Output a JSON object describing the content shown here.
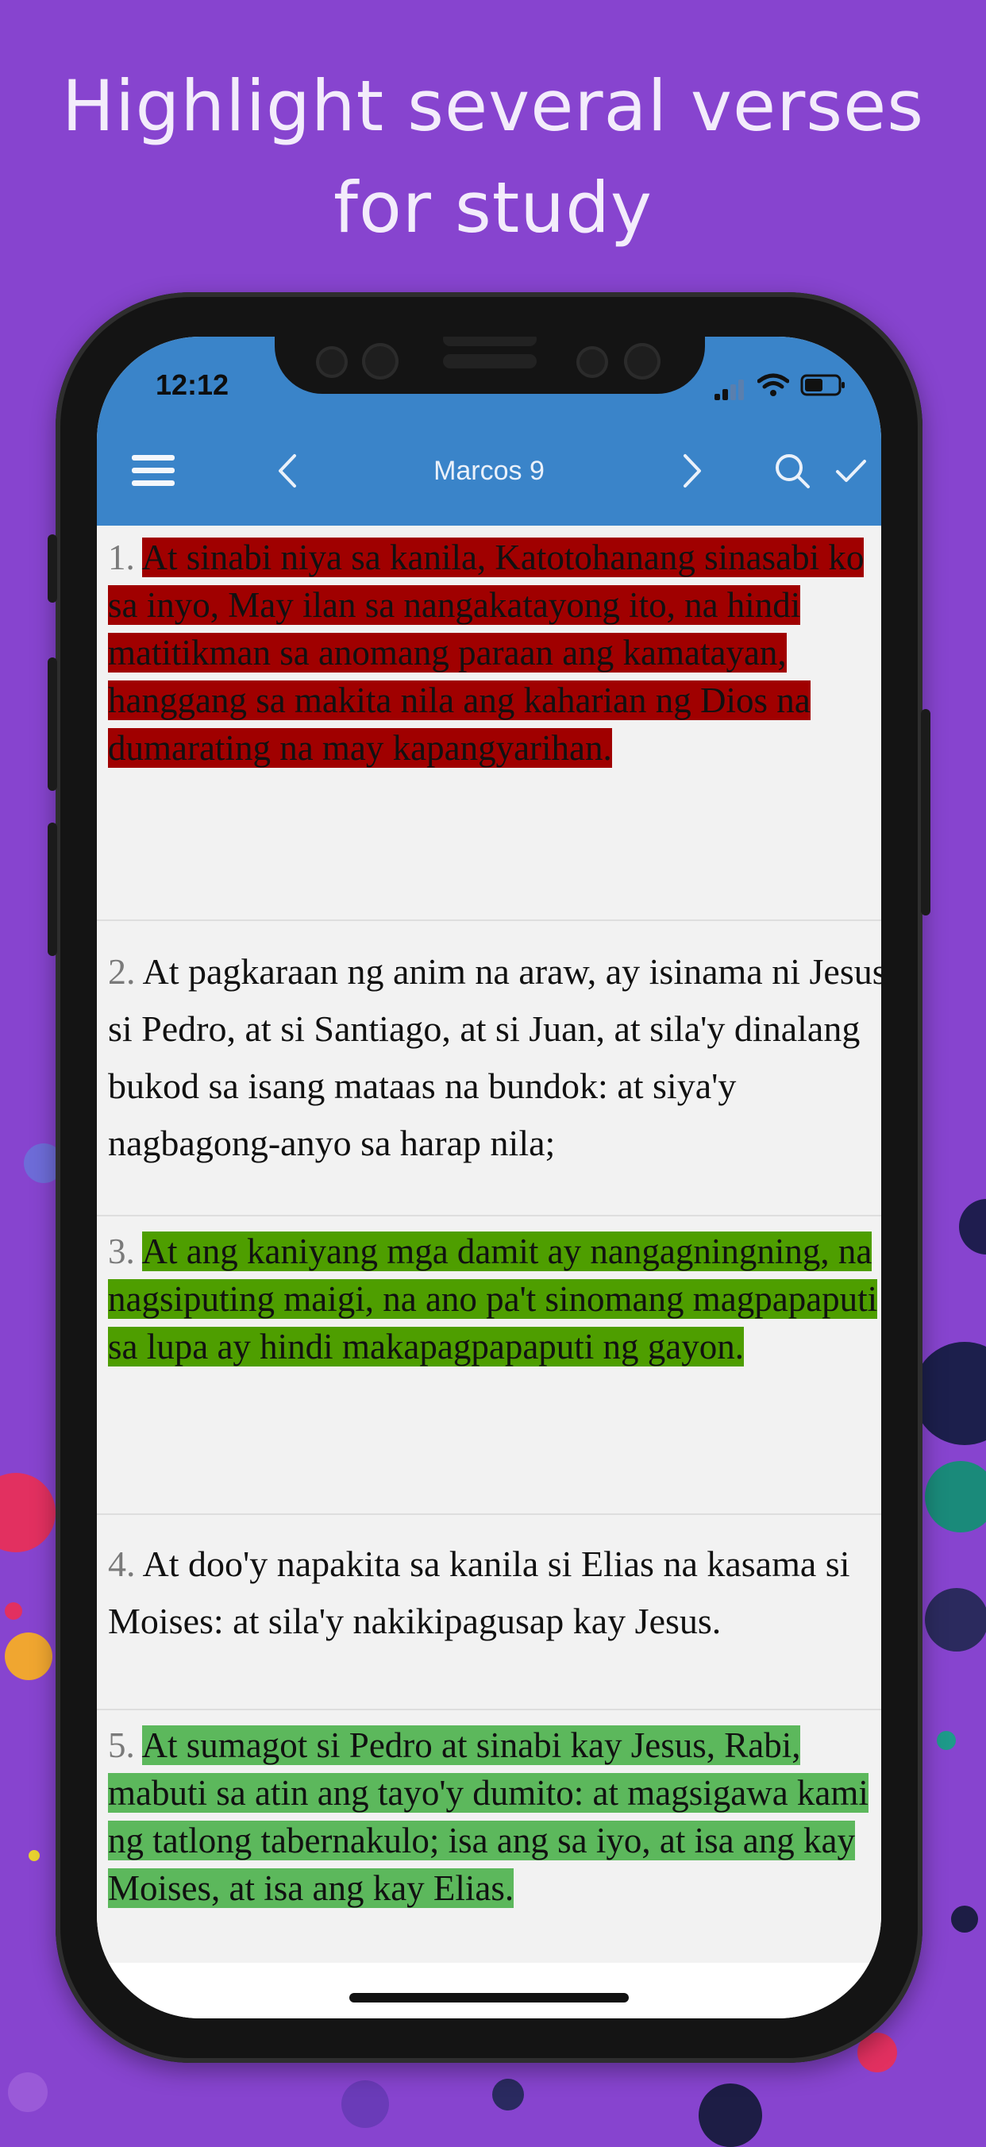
{
  "headline": {
    "line1": "Highlight several verses",
    "line2": "for study"
  },
  "status_bar": {
    "time": "12:12"
  },
  "nav": {
    "title": "Marcos 9",
    "menu_icon": "hamburger-menu-icon",
    "prev_icon": "chevron-left-icon",
    "next_icon": "chevron-right-icon",
    "search_icon": "search-icon",
    "check_icon": "checkmark-icon"
  },
  "colors": {
    "background": "#8744cf",
    "nav_blue": "#3a84c9",
    "highlight_red": "#a00000",
    "highlight_dark_green": "#4e9e00",
    "highlight_light_green": "#5cb85c"
  },
  "verses": [
    {
      "number": "1.",
      "text": "At sinabi niya sa kanila, Katotohanang sinasabi ko sa inyo, May ilan sa nangakatayong ito, na hindi matitikman sa anomang paraan ang kamatayan, hanggang sa makita nila ang kaharian ng Dios na dumarating na may kapangyarihan.",
      "highlight": "#a00000"
    },
    {
      "number": "2.",
      "text": "At pagkaraan ng anim na araw, ay isinama ni Jesus si Pedro, at si Santiago, at si Juan, at sila'y dinalang bukod sa isang mataas na bundok: at siya'y nagbagong-anyo sa harap nila;",
      "highlight": ""
    },
    {
      "number": "3.",
      "text": "At ang kaniyang mga damit ay nangagningning, na nagsiputing maigi, na ano pa't sinomang magpapaputi sa lupa ay hindi makapagpapaputi ng gayon.",
      "highlight": "#4e9e00"
    },
    {
      "number": "4.",
      "text": "At doo'y napakita sa kanila si Elias na kasama si Moises: at sila'y nakikipagusap kay Jesus.",
      "highlight": ""
    },
    {
      "number": "5.",
      "text": "At sumagot si Pedro at sinabi kay Jesus, Rabi, mabuti sa atin ang tayo'y dumito: at magsigawa kami ng tatlong tabernakulo; isa ang sa iyo, at isa ang kay Moises, at isa ang kay Elias.",
      "highlight": "#5cb85c"
    }
  ]
}
